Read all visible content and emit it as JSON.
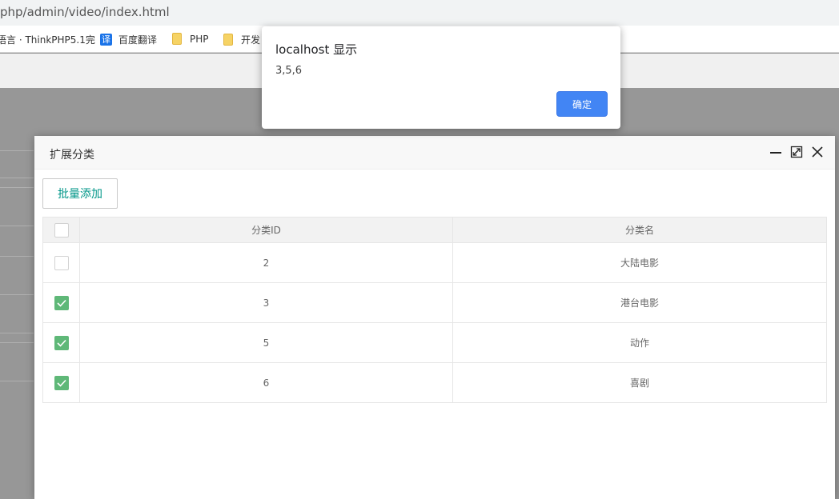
{
  "browser": {
    "url": "php/admin/video/index.html",
    "bookmarks": [
      {
        "label": "语言 · ThinkPHP5.1完"
      },
      {
        "icon": "translate-icon",
        "label": "百度翻译"
      },
      {
        "icon": "folder-icon",
        "label": "PHP"
      },
      {
        "icon": "folder-icon",
        "label": "开发"
      }
    ],
    "translate_glyph": "译"
  },
  "alert": {
    "title": "localhost 显示",
    "message": "3,5,6",
    "ok_label": "确定",
    "ok_color": "#4285f4"
  },
  "layer": {
    "title": "扩展分类",
    "batch_add_label": "批量添加",
    "columns": [
      "分类ID",
      "分类名"
    ],
    "rows": [
      {
        "id": "2",
        "name": "大陆电影",
        "checked": false
      },
      {
        "id": "3",
        "name": "港台电影",
        "checked": true
      },
      {
        "id": "5",
        "name": "动作",
        "checked": true
      },
      {
        "id": "6",
        "name": "喜剧",
        "checked": true
      }
    ],
    "accent_color": "#009688",
    "check_color": "#5fb878"
  }
}
